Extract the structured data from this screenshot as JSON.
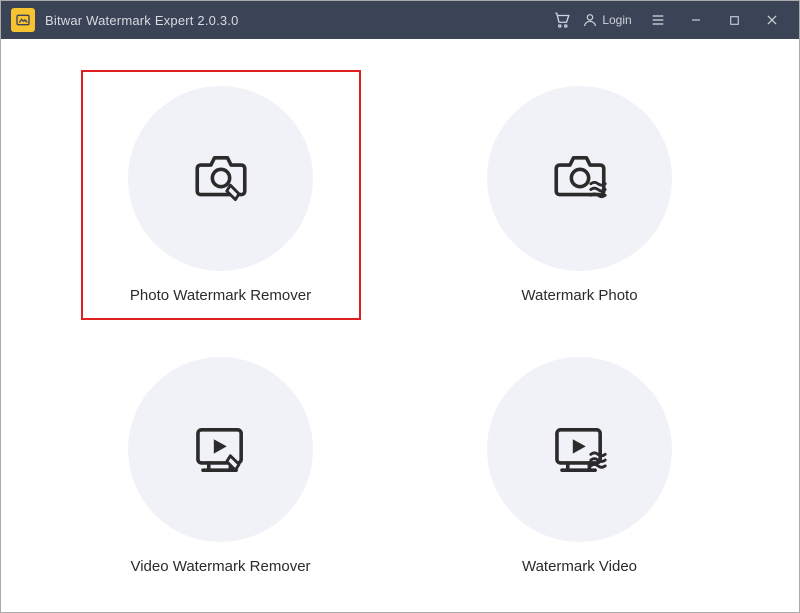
{
  "app": {
    "title": "Bitwar Watermark Expert  2.0.3.0",
    "login_label": "Login"
  },
  "options": [
    {
      "label": "Photo Watermark Remover",
      "highlighted": true
    },
    {
      "label": "Watermark Photo",
      "highlighted": false
    },
    {
      "label": "Video Watermark Remover",
      "highlighted": false
    },
    {
      "label": "Watermark Video",
      "highlighted": false
    }
  ]
}
